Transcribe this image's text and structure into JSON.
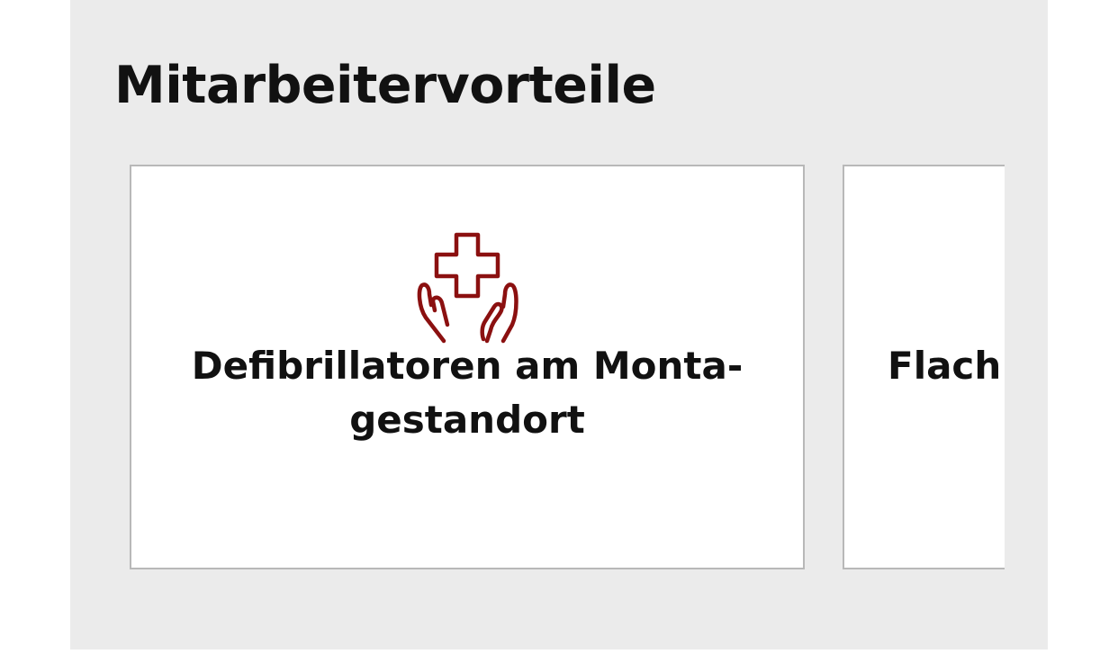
{
  "section": {
    "title": "Mitarbeitervorteile"
  },
  "cards": [
    {
      "title_line1": "Defibrillatoren am Monta-",
      "title_line2": "gestandort",
      "icon": "hands-medical-cross-icon"
    },
    {
      "title": "Flach"
    }
  ],
  "colors": {
    "background": "#ebebeb",
    "card": "#ffffff",
    "card_border": "#b8b8b8",
    "icon": "#8b1010",
    "text": "#111111"
  }
}
